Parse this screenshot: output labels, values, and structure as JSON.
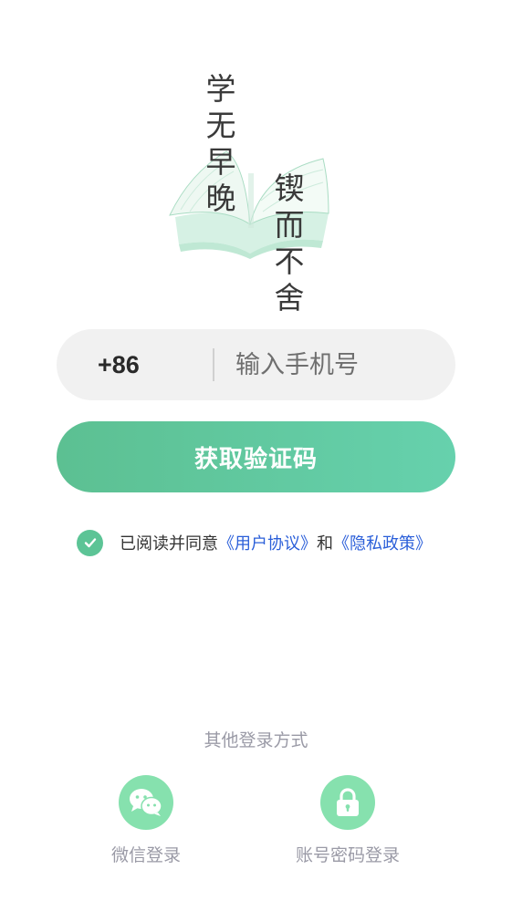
{
  "hero": {
    "text_left": "学无早晚",
    "text_right": "锲而不舍"
  },
  "phone": {
    "country_code": "+86",
    "placeholder": "输入手机号",
    "value": ""
  },
  "get_code_button": {
    "label": "获取验证码"
  },
  "agreement": {
    "checked": true,
    "prefix": "已阅读并同意",
    "user_agreement": "《用户协议》",
    "and": "和",
    "privacy_policy": "《隐私政策》"
  },
  "other_login": {
    "title": "其他登录方式",
    "options": [
      {
        "icon": "wechat-icon",
        "label": "微信登录"
      },
      {
        "icon": "lock-icon",
        "label": "账号密码登录"
      }
    ]
  },
  "colors": {
    "accent": "#5cc496",
    "button_gradient_start": "#5cc092",
    "button_gradient_end": "#66d1ad",
    "icon_circle": "#86e1ae",
    "link": "#2b5fd9",
    "muted_text": "#9a9aa6",
    "input_bg": "#f1f1f1"
  }
}
